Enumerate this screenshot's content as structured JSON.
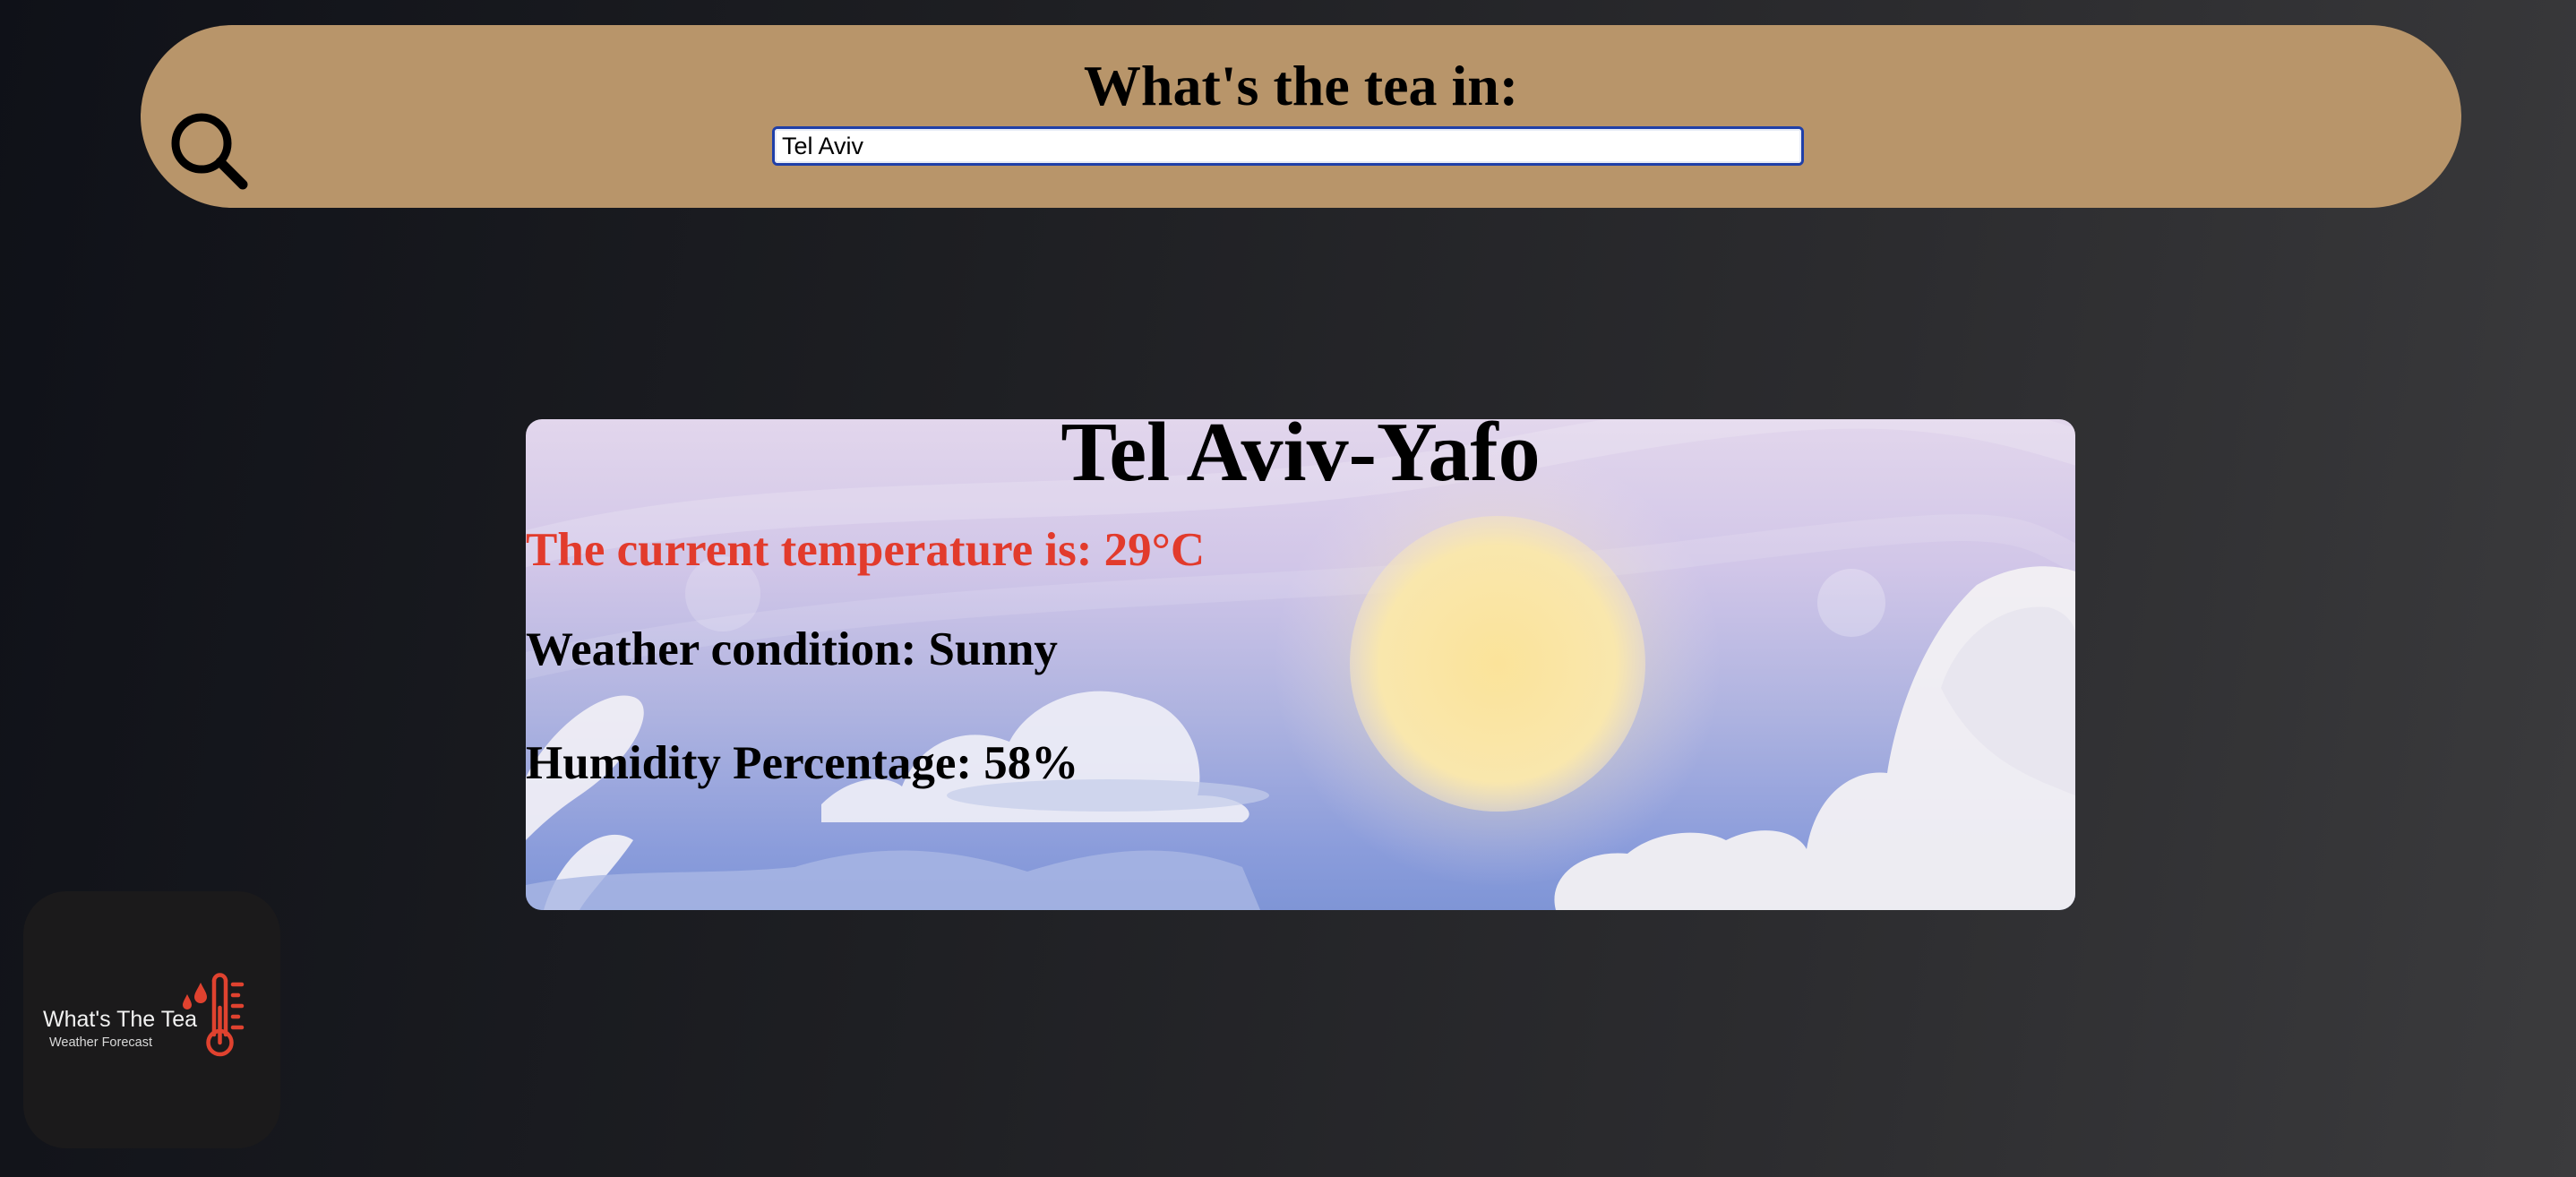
{
  "header": {
    "title": "What's the tea in:",
    "search_icon": "search-icon"
  },
  "search": {
    "value": "Tel Aviv"
  },
  "weather": {
    "city": "Tel Aviv-Yafo",
    "temperature_line": "The current temperature is: 29°C",
    "condition_line": "Weather condition: Sunny",
    "humidity_line": "Humidity Percentage: 58%",
    "background_art": "sunny-sky-illustration"
  },
  "logo": {
    "name": "What's The Tea",
    "tagline": "Weather Forecast",
    "icon": "thermometer-icon"
  },
  "colors": {
    "header_bg": "#b8956a",
    "temperature_text": "#e23b2c",
    "logo_bg": "#1b1a1b",
    "logo_accent": "#e0422f",
    "input_border": "#1f3fa8"
  }
}
